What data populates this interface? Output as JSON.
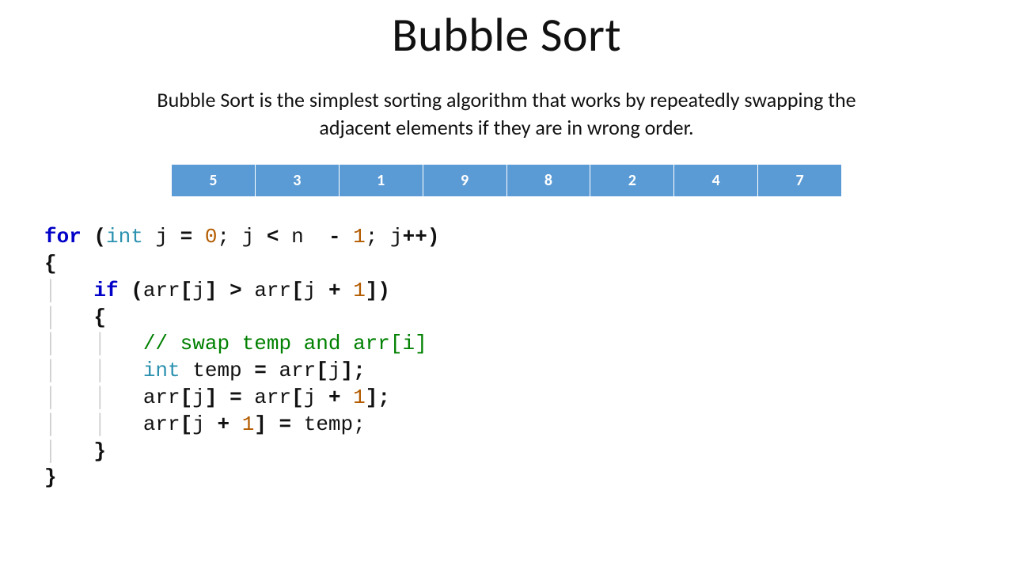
{
  "title": "Bubble Sort",
  "description": "Bubble Sort is the simplest sorting algorithm that works by repeatedly swapping the adjacent elements if they are in wrong order.",
  "array": [
    "5",
    "3",
    "1",
    "9",
    "8",
    "2",
    "4",
    "7"
  ],
  "code": {
    "for_kw": "for",
    "int_ty": "int",
    "j_var": " j ",
    "eq": "= ",
    "zero": "0",
    "semi1": "; ",
    "j2": "j ",
    "lt": "<",
    "n_minus": " n  ",
    "dash": "-",
    "one": " 1",
    "semi2": "; ",
    "j3": "j",
    "pp": "++)",
    "lparen": " (",
    "open_brace": "{",
    "if_kw": "if",
    "if_lparen": " (",
    "arr1": "arr",
    "lb1": "[",
    "j4": "j",
    "rb1": "] ",
    "gt": ">",
    "arr2": " arr",
    "lb2": "[",
    "j5": "j ",
    "plus1": "+ ",
    "one_b": "1",
    "rb2": "])",
    "open_brace2": "{",
    "comment": "// swap temp and arr[i]",
    "int_ty2": "int",
    "temp_decl": " temp ",
    "eq2": "=",
    "arr3": " arr",
    "lb3": "[",
    "j6": "j",
    "rb3": "];",
    "arr4": "arr",
    "lb4": "[",
    "j7": "j",
    "rb4": "] ",
    "eq3": "=",
    "arr5": " arr",
    "lb5": "[",
    "j8": "j ",
    "plus2": "+ ",
    "one_c": "1",
    "rb5": "];",
    "arr6": "arr",
    "lb6": "[",
    "j9": "j ",
    "plus3": "+ ",
    "one_d": "1",
    "rb6": "] ",
    "eq4": "=",
    "temp2": " temp;",
    "close_brace2": "}",
    "close_brace": "}"
  }
}
